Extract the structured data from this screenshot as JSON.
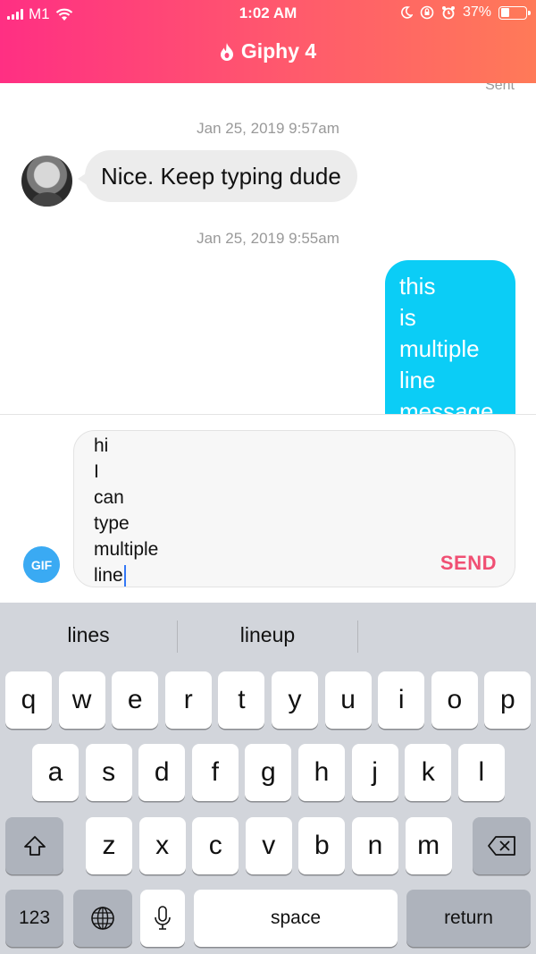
{
  "status_bar": {
    "carrier": "M1",
    "time": "1:02 AM",
    "battery": "37%",
    "battery_level": 0.37
  },
  "header": {
    "title": "Giphy 4",
    "icon": "flame-icon"
  },
  "chat": {
    "sent_label": "Sent",
    "messages": [
      {
        "timestamp": "Jan 25, 2019 9:57am",
        "direction": "incoming",
        "text": "Nice. Keep typing dude"
      },
      {
        "timestamp": "Jan 25, 2019 9:55am",
        "direction": "outgoing",
        "lines": [
          "this",
          "is",
          "multiple",
          "line",
          "message"
        ]
      }
    ]
  },
  "composer": {
    "gif_label": "GIF",
    "input_lines": [
      "hi",
      "I",
      "can",
      "type",
      "multiple",
      "line"
    ],
    "send_label": "SEND"
  },
  "keyboard": {
    "suggestions": [
      "lines",
      "lineup",
      ""
    ],
    "row1": [
      "q",
      "w",
      "e",
      "r",
      "t",
      "y",
      "u",
      "i",
      "o",
      "p"
    ],
    "row2": [
      "a",
      "s",
      "d",
      "f",
      "g",
      "h",
      "j",
      "k",
      "l"
    ],
    "row3": [
      "z",
      "x",
      "c",
      "v",
      "b",
      "n",
      "m"
    ],
    "numbers_label": "123",
    "space_label": "space",
    "return_label": "return"
  },
  "colors": {
    "header_gradient_start": "#ff2f83",
    "header_gradient_end": "#ff7a58",
    "outgoing_bubble": "#0bcdf6",
    "incoming_bubble": "#ececec",
    "send": "#f04f73",
    "gif_button": "#3aaaf3"
  }
}
